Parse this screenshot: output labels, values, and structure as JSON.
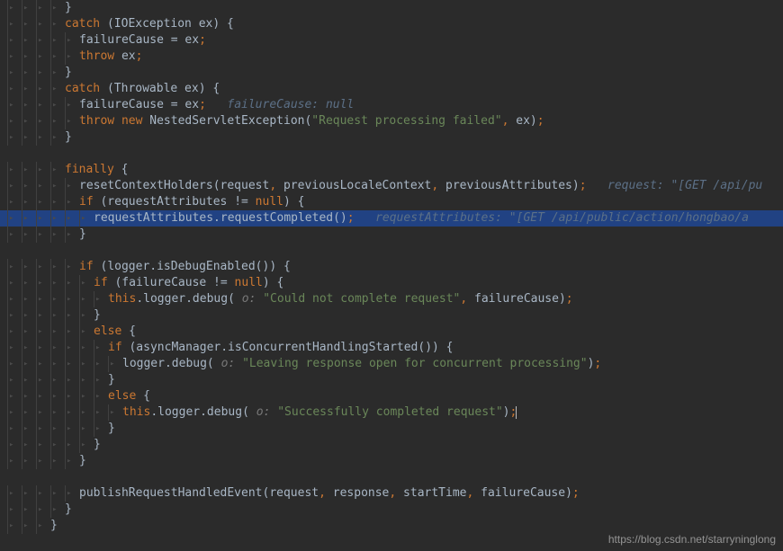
{
  "watermark": "https://blog.csdn.net/starryninglong",
  "lines": [
    {
      "indent": 4,
      "highlighted": false,
      "tokens": [
        {
          "t": "bracket",
          "v": "}"
        }
      ]
    },
    {
      "indent": 4,
      "highlighted": false,
      "tokens": [
        {
          "t": "kw",
          "v": "catch"
        },
        {
          "t": "bracket",
          "v": " (IOException ex) {"
        }
      ]
    },
    {
      "indent": 5,
      "highlighted": false,
      "tokens": [
        {
          "t": "ident",
          "v": "failureCause = ex"
        },
        {
          "t": "punct",
          "v": ";"
        }
      ]
    },
    {
      "indent": 5,
      "highlighted": false,
      "tokens": [
        {
          "t": "kw",
          "v": "throw"
        },
        {
          "t": "ident",
          "v": " ex"
        },
        {
          "t": "punct",
          "v": ";"
        }
      ]
    },
    {
      "indent": 4,
      "highlighted": false,
      "tokens": [
        {
          "t": "bracket",
          "v": "}"
        }
      ]
    },
    {
      "indent": 4,
      "highlighted": false,
      "tokens": [
        {
          "t": "kw",
          "v": "catch"
        },
        {
          "t": "bracket",
          "v": " (Throwable ex) {"
        }
      ]
    },
    {
      "indent": 5,
      "highlighted": false,
      "tokens": [
        {
          "t": "ident",
          "v": "failureCause = ex"
        },
        {
          "t": "punct",
          "v": ";"
        },
        {
          "t": "ident",
          "v": "   "
        },
        {
          "t": "hint",
          "v": "failureCause: null"
        }
      ]
    },
    {
      "indent": 5,
      "highlighted": false,
      "tokens": [
        {
          "t": "kw",
          "v": "throw new"
        },
        {
          "t": "ident",
          "v": " NestedServletException("
        },
        {
          "t": "str",
          "v": "\"Request processing failed\""
        },
        {
          "t": "punct",
          "v": ","
        },
        {
          "t": "ident",
          "v": " ex)"
        },
        {
          "t": "punct",
          "v": ";"
        }
      ]
    },
    {
      "indent": 4,
      "highlighted": false,
      "tokens": [
        {
          "t": "bracket",
          "v": "}"
        }
      ]
    },
    {
      "indent": 0,
      "highlighted": false,
      "tokens": []
    },
    {
      "indent": 4,
      "highlighted": false,
      "tokens": [
        {
          "t": "kw",
          "v": "finally"
        },
        {
          "t": "bracket",
          "v": " {"
        }
      ]
    },
    {
      "indent": 5,
      "highlighted": false,
      "tokens": [
        {
          "t": "ident",
          "v": "resetContextHolders(request"
        },
        {
          "t": "punct",
          "v": ","
        },
        {
          "t": "ident",
          "v": " previousLocaleContext"
        },
        {
          "t": "punct",
          "v": ","
        },
        {
          "t": "ident",
          "v": " previousAttributes)"
        },
        {
          "t": "punct",
          "v": ";"
        },
        {
          "t": "ident",
          "v": "   "
        },
        {
          "t": "hint",
          "v": "request: \"[GET /api/pu"
        }
      ]
    },
    {
      "indent": 5,
      "highlighted": false,
      "tokens": [
        {
          "t": "kw",
          "v": "if"
        },
        {
          "t": "bracket",
          "v": " (requestAttributes != "
        },
        {
          "t": "kw",
          "v": "null"
        },
        {
          "t": "bracket",
          "v": ") {"
        }
      ]
    },
    {
      "indent": 6,
      "highlighted": true,
      "tokens": [
        {
          "t": "ident",
          "v": "requestAttributes.requestCompleted()"
        },
        {
          "t": "punct",
          "v": ";"
        },
        {
          "t": "ident",
          "v": "   "
        },
        {
          "t": "hint",
          "v": "requestAttributes: \"[GET /api/public/action/hongbao/a"
        }
      ]
    },
    {
      "indent": 5,
      "highlighted": false,
      "tokens": [
        {
          "t": "bracket",
          "v": "}"
        }
      ]
    },
    {
      "indent": 0,
      "highlighted": false,
      "tokens": []
    },
    {
      "indent": 5,
      "highlighted": false,
      "tokens": [
        {
          "t": "kw",
          "v": "if"
        },
        {
          "t": "bracket",
          "v": " ("
        },
        {
          "t": "ident",
          "v": "logger"
        },
        {
          "t": "bracket",
          "v": ".isDebugEnabled()) {"
        }
      ]
    },
    {
      "indent": 6,
      "highlighted": false,
      "tokens": [
        {
          "t": "kw",
          "v": "if"
        },
        {
          "t": "bracket",
          "v": " (failureCause != "
        },
        {
          "t": "kw",
          "v": "null"
        },
        {
          "t": "bracket",
          "v": ") {"
        }
      ]
    },
    {
      "indent": 7,
      "highlighted": false,
      "tokens": [
        {
          "t": "kw",
          "v": "this"
        },
        {
          "t": "ident",
          "v": "."
        },
        {
          "t": "ident",
          "v": "logger"
        },
        {
          "t": "ident",
          "v": ".debug( "
        },
        {
          "t": "paramhint",
          "v": "o: "
        },
        {
          "t": "str",
          "v": "\"Could not complete request\""
        },
        {
          "t": "punct",
          "v": ","
        },
        {
          "t": "ident",
          "v": " failureCause)"
        },
        {
          "t": "punct",
          "v": ";"
        }
      ]
    },
    {
      "indent": 6,
      "highlighted": false,
      "tokens": [
        {
          "t": "bracket",
          "v": "}"
        }
      ]
    },
    {
      "indent": 6,
      "highlighted": false,
      "tokens": [
        {
          "t": "kw",
          "v": "else"
        },
        {
          "t": "bracket",
          "v": " {"
        }
      ]
    },
    {
      "indent": 7,
      "highlighted": false,
      "tokens": [
        {
          "t": "kw",
          "v": "if"
        },
        {
          "t": "bracket",
          "v": " (asyncManager.isConcurrentHandlingStarted()) {"
        }
      ]
    },
    {
      "indent": 8,
      "highlighted": false,
      "tokens": [
        {
          "t": "ident",
          "v": "logger"
        },
        {
          "t": "ident",
          "v": ".debug( "
        },
        {
          "t": "paramhint",
          "v": "o: "
        },
        {
          "t": "str",
          "v": "\"Leaving response open for concurrent processing\""
        },
        {
          "t": "ident",
          "v": ")"
        },
        {
          "t": "punct",
          "v": ";"
        }
      ]
    },
    {
      "indent": 7,
      "highlighted": false,
      "tokens": [
        {
          "t": "bracket",
          "v": "}"
        }
      ]
    },
    {
      "indent": 7,
      "highlighted": false,
      "tokens": [
        {
          "t": "kw",
          "v": "else"
        },
        {
          "t": "bracket",
          "v": " {"
        }
      ]
    },
    {
      "indent": 8,
      "highlighted": false,
      "cursor": true,
      "tokens": [
        {
          "t": "kw",
          "v": "this"
        },
        {
          "t": "ident",
          "v": "."
        },
        {
          "t": "ident",
          "v": "logger"
        },
        {
          "t": "ident",
          "v": ".debug( "
        },
        {
          "t": "paramhint",
          "v": "o: "
        },
        {
          "t": "str",
          "v": "\"Successfully completed request\""
        },
        {
          "t": "ident",
          "v": ")"
        },
        {
          "t": "punct",
          "v": ";"
        }
      ]
    },
    {
      "indent": 7,
      "highlighted": false,
      "tokens": [
        {
          "t": "bracket",
          "v": "}"
        }
      ]
    },
    {
      "indent": 6,
      "highlighted": false,
      "tokens": [
        {
          "t": "bracket",
          "v": "}"
        }
      ]
    },
    {
      "indent": 5,
      "highlighted": false,
      "tokens": [
        {
          "t": "bracket",
          "v": "}"
        }
      ]
    },
    {
      "indent": 0,
      "highlighted": false,
      "tokens": []
    },
    {
      "indent": 5,
      "highlighted": false,
      "tokens": [
        {
          "t": "ident",
          "v": "publishRequestHandledEvent(request"
        },
        {
          "t": "punct",
          "v": ","
        },
        {
          "t": "ident",
          "v": " response"
        },
        {
          "t": "punct",
          "v": ","
        },
        {
          "t": "ident",
          "v": " startTime"
        },
        {
          "t": "punct",
          "v": ","
        },
        {
          "t": "ident",
          "v": " failureCause)"
        },
        {
          "t": "punct",
          "v": ";"
        }
      ]
    },
    {
      "indent": 4,
      "highlighted": false,
      "tokens": [
        {
          "t": "bracket",
          "v": "}"
        }
      ]
    },
    {
      "indent": 3,
      "highlighted": false,
      "tokens": [
        {
          "t": "bracket",
          "v": "}"
        }
      ]
    }
  ]
}
